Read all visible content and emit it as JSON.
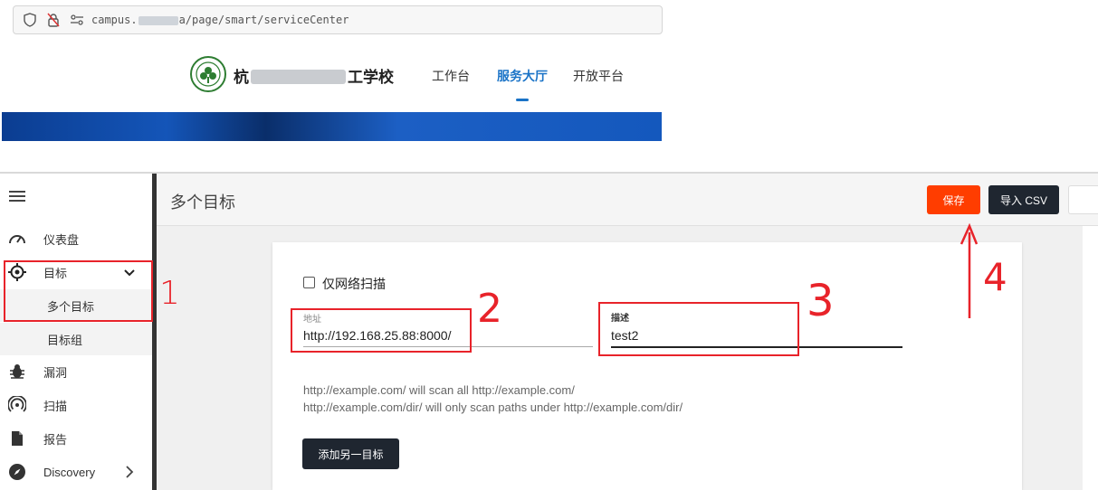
{
  "browser": {
    "url_prefix": "campus.",
    "url_suffix": "a/page/smart/serviceCenter"
  },
  "site": {
    "school_name_start": "杭",
    "school_name_end": "工学校",
    "nav": [
      "工作台",
      "服务大厅",
      "开放平台"
    ],
    "active_nav": "服务大厅"
  },
  "sidebar": {
    "items": [
      {
        "label": "仪表盘",
        "icon": "speedometer-icon"
      },
      {
        "label": "目标",
        "icon": "target-icon",
        "expanded": true
      },
      {
        "label": "多个目标",
        "sub": true,
        "active": true
      },
      {
        "label": "目标组",
        "sub": true
      },
      {
        "label": "漏洞",
        "icon": "bug-icon"
      },
      {
        "label": "扫描",
        "icon": "radar-icon"
      },
      {
        "label": "报告",
        "icon": "document-icon"
      },
      {
        "label": "Discovery",
        "icon": "compass-icon"
      }
    ]
  },
  "header": {
    "title": "多个目标",
    "save_label": "保存",
    "import_label": "导入 CSV"
  },
  "form": {
    "network_only_label": "仅网络扫描",
    "network_only_checked": false,
    "address_label": "地址",
    "address_value": "http://192.168.25.88:8000/",
    "description_label": "描述",
    "description_value": "test2",
    "hint_line1": "http://example.com/ will scan all http://example.com/",
    "hint_line2": "http://example.com/dir/ will only scan paths under http://example.com/dir/",
    "add_target_label": "添加另一目标"
  },
  "annotations": {
    "numbers": [
      "1",
      "2",
      "3",
      "4"
    ],
    "color": "#e8232a"
  },
  "colors": {
    "accent_blue": "#1a73c7",
    "save_orange": "#ff3d00",
    "dark_button": "#1f2630"
  }
}
